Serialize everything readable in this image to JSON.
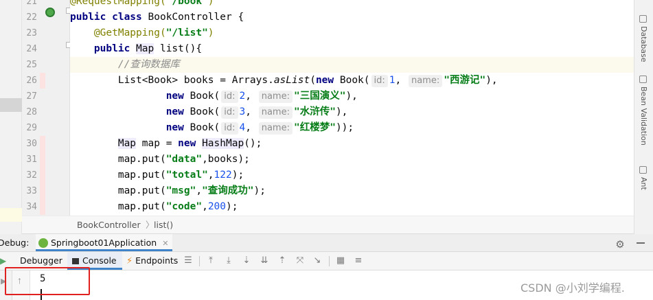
{
  "editor": {
    "lines": [
      {
        "n": "21",
        "tokens": [
          [
            "ann",
            "@RequestMapping("
          ],
          [
            "str",
            "\"/book\""
          ],
          [
            "ann",
            ")"
          ]
        ]
      },
      {
        "n": "22",
        "tokens": [
          [
            "kw",
            "public class "
          ],
          [
            "",
            "BookController {"
          ]
        ]
      },
      {
        "n": "23",
        "tokens": [
          [
            "",
            "    "
          ],
          [
            "ann",
            "@GetMapping("
          ],
          [
            "str",
            "\"/list\""
          ],
          [
            "ann",
            ")"
          ]
        ]
      },
      {
        "n": "24",
        "tokens": [
          [
            "",
            "    "
          ],
          [
            "kw",
            "public "
          ],
          [
            "hlt",
            "Map"
          ],
          [
            "",
            " list(){"
          ]
        ]
      },
      {
        "n": "25",
        "tokens": [
          [
            "",
            "        "
          ],
          [
            "cmt",
            "//查询数据库"
          ]
        ]
      },
      {
        "n": "26",
        "tokens": [
          [
            "",
            "        List<Book> books = Arrays."
          ],
          [
            "ital",
            "asList"
          ],
          [
            "",
            "("
          ],
          [
            "kw",
            "new "
          ],
          [
            "",
            "Book("
          ],
          [
            "hint",
            "id:"
          ],
          [
            "num",
            "1"
          ],
          [
            "",
            ", "
          ],
          [
            "hint",
            "name:"
          ],
          [
            "str",
            "\"西游记\""
          ],
          [
            "",
            "),"
          ]
        ]
      },
      {
        "n": "27",
        "tokens": [
          [
            "",
            "                "
          ],
          [
            "kw",
            "new "
          ],
          [
            "",
            "Book("
          ],
          [
            "hint",
            "id:"
          ],
          [
            "num",
            "2"
          ],
          [
            "",
            ", "
          ],
          [
            "hint",
            "name:"
          ],
          [
            "str",
            "\"三国演义\""
          ],
          [
            "",
            "),"
          ]
        ]
      },
      {
        "n": "28",
        "tokens": [
          [
            "",
            "                "
          ],
          [
            "kw",
            "new "
          ],
          [
            "",
            "Book("
          ],
          [
            "hint",
            "id:"
          ],
          [
            "num",
            "3"
          ],
          [
            "",
            ", "
          ],
          [
            "hint",
            "name:"
          ],
          [
            "str",
            "\"水浒传\""
          ],
          [
            "",
            "),"
          ]
        ]
      },
      {
        "n": "29",
        "tokens": [
          [
            "",
            "                "
          ],
          [
            "kw",
            "new "
          ],
          [
            "",
            "Book("
          ],
          [
            "hint",
            "id:"
          ],
          [
            "num",
            "4"
          ],
          [
            "",
            ", "
          ],
          [
            "hint",
            "name:"
          ],
          [
            "str",
            "\"红楼梦\""
          ],
          [
            "",
            "));"
          ]
        ]
      },
      {
        "n": "30",
        "tokens": [
          [
            "",
            "        "
          ],
          [
            "hlt",
            "Map"
          ],
          [
            "",
            " map = "
          ],
          [
            "kw",
            "new "
          ],
          [
            "hlt",
            "HashMap"
          ],
          [
            "",
            "();"
          ]
        ]
      },
      {
        "n": "31",
        "tokens": [
          [
            "",
            "        map.put("
          ],
          [
            "str",
            "\"data\""
          ],
          [
            "",
            ",books);"
          ]
        ]
      },
      {
        "n": "32",
        "tokens": [
          [
            "",
            "        map.put("
          ],
          [
            "str",
            "\"total\""
          ],
          [
            "",
            ","
          ],
          [
            "num",
            "122"
          ],
          [
            "",
            ");"
          ]
        ]
      },
      {
        "n": "33",
        "tokens": [
          [
            "",
            "        map.put("
          ],
          [
            "str",
            "\"msg\""
          ],
          [
            "",
            ","
          ],
          [
            "str",
            "\"查询成功\""
          ],
          [
            "",
            ");"
          ]
        ]
      },
      {
        "n": "34",
        "tokens": [
          [
            "",
            "        map.put("
          ],
          [
            "str",
            "\"code\""
          ],
          [
            "",
            ","
          ],
          [
            "num",
            "200"
          ],
          [
            "",
            ");"
          ]
        ]
      }
    ]
  },
  "right_tabs": [
    "Database",
    "Bean Validation",
    "Ant"
  ],
  "breadcrumb": {
    "class_name": "BookController",
    "separator": "〉",
    "method_name": "list()"
  },
  "debug": {
    "label": "Debug:",
    "run_config": "Springboot01Application",
    "close_glyph": "✕",
    "gear_glyph": "⚙",
    "tabs": {
      "debugger": "Debugger",
      "console": "Console",
      "endpoints": "Endpoints"
    }
  },
  "console": {
    "output": "5"
  },
  "watermark": "CSDN @小刘学编程."
}
